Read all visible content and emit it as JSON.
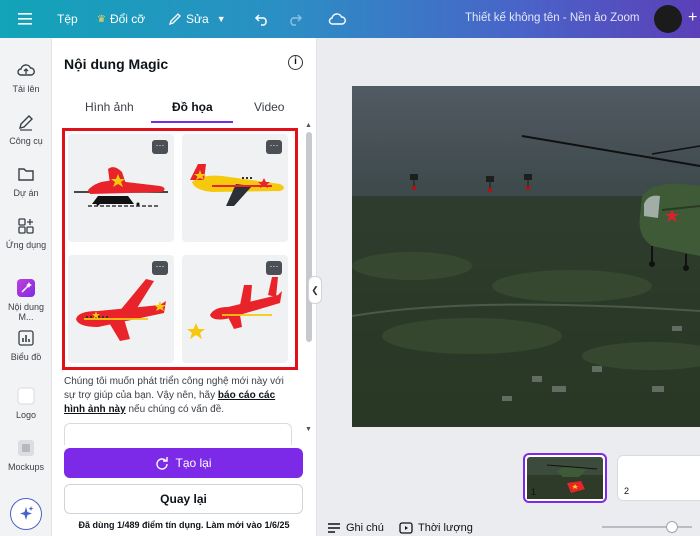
{
  "topbar": {
    "file_label": "Tệp",
    "resize_label": "Đổi cỡ",
    "edit_label": "Sửa",
    "doc_title": "Thiết kế không tên - Nền ảo Zoom",
    "plus": "+"
  },
  "rail": {
    "items": [
      {
        "label": "Tải lên",
        "icon": "cloud-upload-icon"
      },
      {
        "label": "Công cụ",
        "icon": "pen-icon"
      },
      {
        "label": "Dự án",
        "icon": "folder-icon"
      },
      {
        "label": "Ứng dụng",
        "icon": "apps-icon"
      },
      {
        "label": "Nội dung M...",
        "icon": "magic-content-icon"
      },
      {
        "label": "Biểu đồ",
        "icon": "chart-icon"
      },
      {
        "label": "Logo",
        "icon": "logo-icon"
      },
      {
        "label": "Mockups",
        "icon": "mockups-icon"
      }
    ]
  },
  "panel": {
    "title": "Nội dung Magic",
    "info": "i",
    "tabs": [
      {
        "label": "Hình ảnh"
      },
      {
        "label": "Đồ họa",
        "active": true
      },
      {
        "label": "Video"
      }
    ],
    "more": "···",
    "note_pre": "Chúng tôi muốn phát triển công nghệ mới này với sự trợ giúp của bạn. Vậy nên, hãy ",
    "note_link": "báo cáo các hình ảnh này",
    "note_post": " nếu chúng có vấn đề.",
    "retry_label": "Tạo lại",
    "back_label": "Quay lại",
    "credits": "Đã dùng 1/489 điểm tín dụng. Làm mới vào 1/6/25"
  },
  "pages": {
    "page1": "1",
    "page2": "2"
  },
  "bottom": {
    "notes_label": "Ghi chú",
    "duration_label": "Thời lượng"
  },
  "colors": {
    "accent": "#7d2ae8",
    "highlight_border": "#e0111b",
    "plane_red": "#e8232a",
    "star_yellow": "#f6c90e"
  }
}
